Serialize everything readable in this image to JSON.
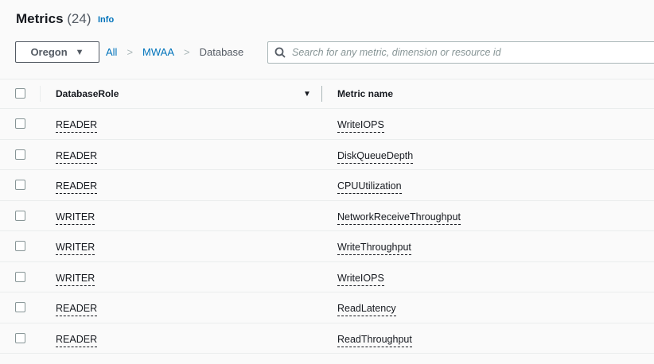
{
  "header": {
    "title": "Metrics",
    "count": "(24)",
    "info": "Info"
  },
  "toolbar": {
    "region": "Oregon",
    "breadcrumb": [
      "All",
      "MWAA",
      "Database"
    ],
    "search_placeholder": "Search for any metric, dimension or resource id"
  },
  "table": {
    "columns": [
      "DatabaseRole",
      "Metric name"
    ],
    "rows": [
      {
        "role": "READER",
        "metric": "WriteIOPS"
      },
      {
        "role": "READER",
        "metric": "DiskQueueDepth"
      },
      {
        "role": "READER",
        "metric": "CPUUtilization"
      },
      {
        "role": "WRITER",
        "metric": "NetworkReceiveThroughput"
      },
      {
        "role": "WRITER",
        "metric": "WriteThroughput"
      },
      {
        "role": "WRITER",
        "metric": "WriteIOPS"
      },
      {
        "role": "READER",
        "metric": "ReadLatency"
      },
      {
        "role": "READER",
        "metric": "ReadThroughput"
      }
    ]
  }
}
